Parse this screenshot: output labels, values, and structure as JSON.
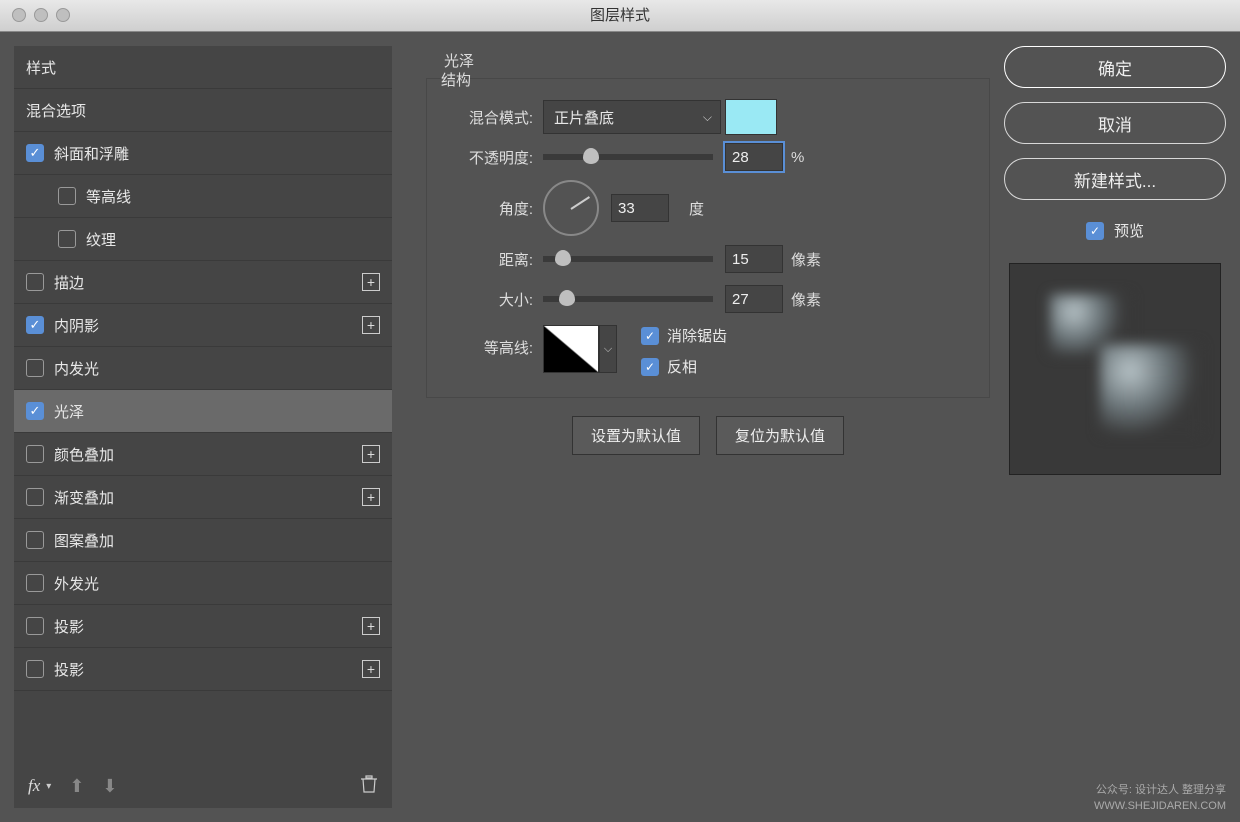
{
  "window": {
    "title": "图层样式"
  },
  "sidebar": {
    "header": "样式",
    "items": [
      {
        "label": "混合选项",
        "checked": null,
        "plus": false
      },
      {
        "label": "斜面和浮雕",
        "checked": true,
        "plus": false
      },
      {
        "label": "等高线",
        "checked": false,
        "plus": false,
        "indent": true
      },
      {
        "label": "纹理",
        "checked": false,
        "plus": false,
        "indent": true
      },
      {
        "label": "描边",
        "checked": false,
        "plus": true
      },
      {
        "label": "内阴影",
        "checked": true,
        "plus": true
      },
      {
        "label": "内发光",
        "checked": false,
        "plus": false
      },
      {
        "label": "光泽",
        "checked": true,
        "plus": false,
        "selected": true
      },
      {
        "label": "颜色叠加",
        "checked": false,
        "plus": true
      },
      {
        "label": "渐变叠加",
        "checked": false,
        "plus": true
      },
      {
        "label": "图案叠加",
        "checked": false,
        "plus": false
      },
      {
        "label": "外发光",
        "checked": false,
        "plus": false
      },
      {
        "label": "投影",
        "checked": false,
        "plus": true
      },
      {
        "label": "投影",
        "checked": false,
        "plus": true
      }
    ],
    "footer": {
      "fx": "fx"
    }
  },
  "panel": {
    "title": "光泽",
    "section": "结构",
    "blend_mode_label": "混合模式:",
    "blend_mode_value": "正片叠底",
    "swatch_color": "#9ae9f4",
    "opacity_label": "不透明度:",
    "opacity_value": "28",
    "opacity_unit": "%",
    "angle_label": "角度:",
    "angle_value": "33",
    "angle_unit": "度",
    "distance_label": "距离:",
    "distance_value": "15",
    "distance_unit": "像素",
    "size_label": "大小:",
    "size_value": "27",
    "size_unit": "像素",
    "contour_label": "等高线:",
    "antialias_label": "消除锯齿",
    "invert_label": "反相",
    "antialias_checked": true,
    "invert_checked": true,
    "set_default": "设置为默认值",
    "reset_default": "复位为默认值"
  },
  "right": {
    "ok": "确定",
    "cancel": "取消",
    "new_style": "新建样式...",
    "preview_label": "预览"
  },
  "watermark": {
    "line1": "公众号: 设计达人 整理分享",
    "line2": "WWW.SHEJIDAREN.COM"
  }
}
